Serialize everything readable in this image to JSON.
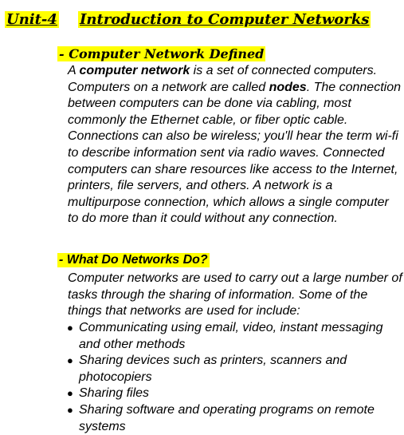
{
  "header": {
    "unit": "Unit-4",
    "title": "Introduction to Computer Networks"
  },
  "section1": {
    "heading": "- Computer Network Defined",
    "text_a": "A ",
    "bold_term": "computer network",
    "text_b": " is a set of connected computers. Computers on a network are called ",
    "bold_nodes": "nodes",
    "text_c": ". The connection between computers can be done via cabling, most commonly the Ethernet cable, or fiber optic cable. Connections can also be wireless; you'll hear the term wi-fi to describe information sent via radio waves. Connected computers can share resources like access to the Internet, printers, file servers, and others. A network is a multipurpose connection, which allows a single computer to do more than it could without any connection."
  },
  "section2": {
    "heading": "- What Do Networks Do?",
    "intro": "Computer networks are used to carry out a large number of tasks through the sharing of information. Some of the things that networks are used for include:",
    "bullet_symbol": "●",
    "bullets": [
      "Communicating using email, video, instant messaging and other methods",
      "Sharing devices such as printers, scanners and photocopiers",
      "Sharing files",
      "Sharing software and operating programs on remote systems"
    ]
  }
}
